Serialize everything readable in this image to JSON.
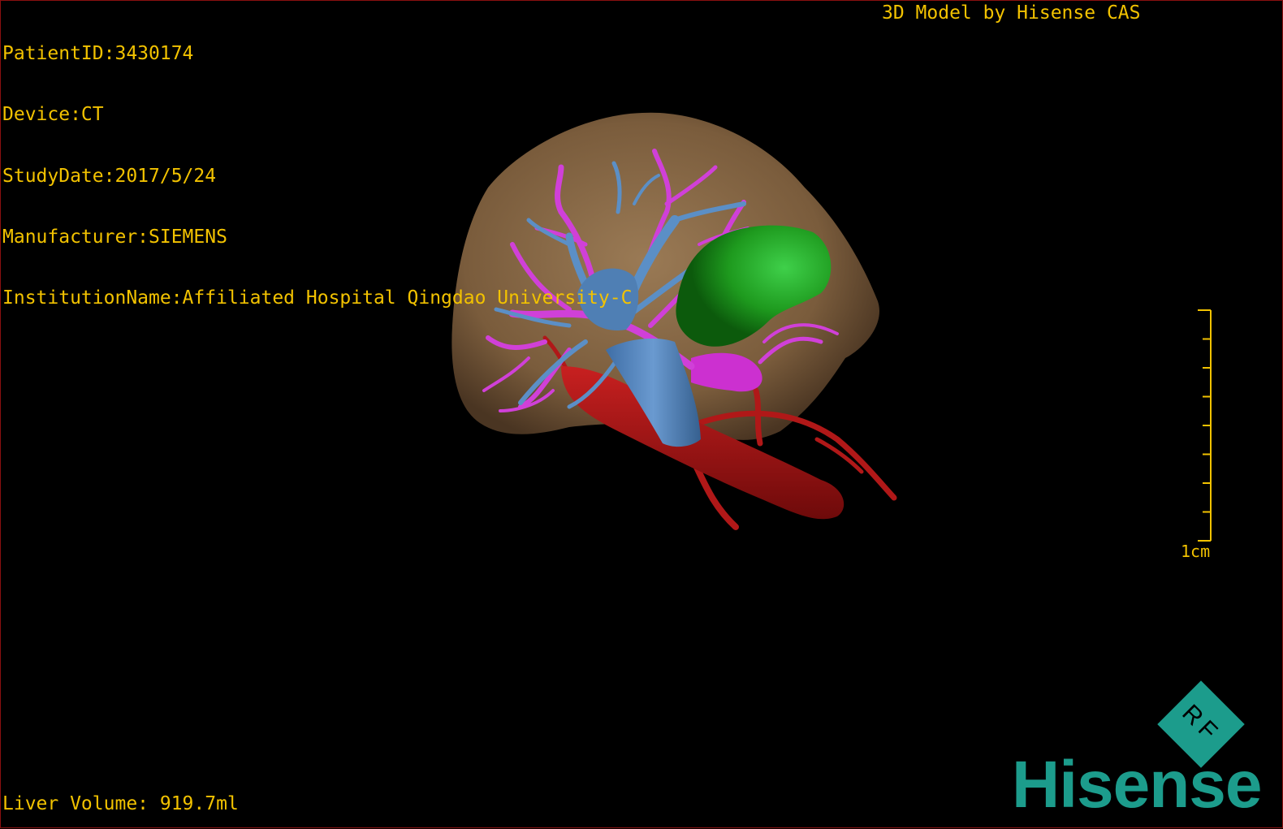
{
  "info": {
    "patient_id": "PatientID:3430174",
    "device": "Device:CT",
    "study_date": "StudyDate:2017/5/24",
    "manufacturer": "Manufacturer:SIEMENS",
    "institution": "InstitutionName:Affiliated Hospital Qingdao University-C"
  },
  "credit": "3D Model by Hisense CAS",
  "volume": "Liver Volume: 919.7ml",
  "scale": {
    "label": "1cm"
  },
  "brand": {
    "logo_text": "Hisense",
    "badge_text": "RF"
  },
  "colors": {
    "overlay_text": "#f2c200",
    "liver": "#8b6a45",
    "portal_vein": "#d040d8",
    "hepatic_vein": "#5b8fc6",
    "artery": "#b01818",
    "lesion": "#1e9a1e",
    "brand": "#1c9c8c"
  }
}
